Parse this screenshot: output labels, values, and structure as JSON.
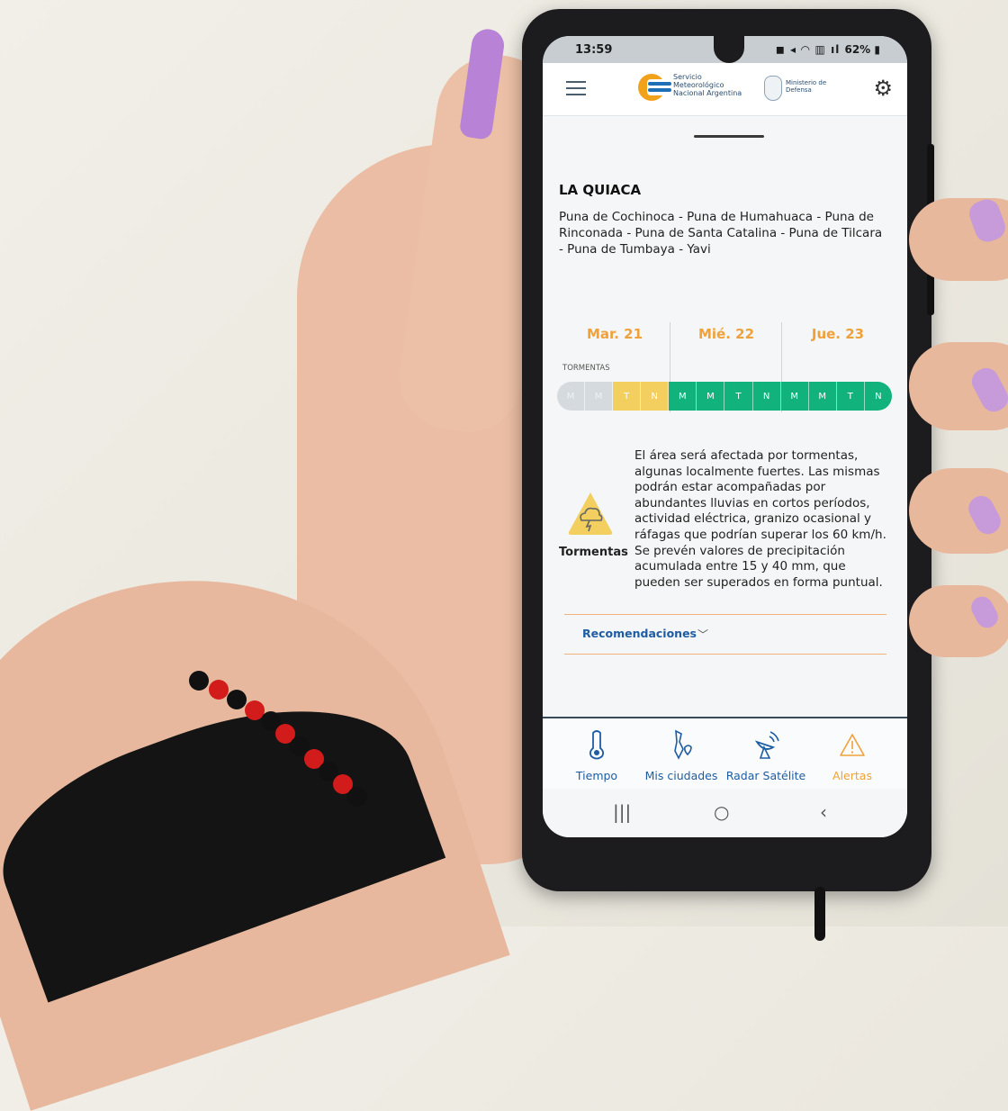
{
  "status_bar": {
    "time": "13:59",
    "icons": "62%",
    "battery": "62%"
  },
  "app_bar": {
    "logo_text": "Servicio Meteorológico Nacional Argentina",
    "ministry_text": "Ministerio de Defensa"
  },
  "alert": {
    "location": "LA QUIACA",
    "zones": "Puna de Cochinoca - Puna de Humahuaca - Puna de Rinconada - Puna de Santa Catalina - Puna de Tilcara - Puna de Tumbaya - Yavi",
    "days": [
      "Mar. 21",
      "Mié. 22",
      "Jue. 23"
    ],
    "risk_label": "TORMENTAS",
    "periods": [
      {
        "label": "M",
        "level": "none"
      },
      {
        "label": "M",
        "level": "none"
      },
      {
        "label": "T",
        "level": "yellow"
      },
      {
        "label": "N",
        "level": "yellow"
      },
      {
        "label": "M",
        "level": "green"
      },
      {
        "label": "M",
        "level": "green"
      },
      {
        "label": "T",
        "level": "green"
      },
      {
        "label": "N",
        "level": "green"
      },
      {
        "label": "M",
        "level": "green"
      },
      {
        "label": "M",
        "level": "green"
      },
      {
        "label": "T",
        "level": "green"
      },
      {
        "label": "N",
        "level": "green"
      }
    ],
    "level_colors": {
      "none": "#d4dade",
      "yellow": "#f3cf5f",
      "green": "#12b27c"
    },
    "event_name": "Tormentas",
    "description": "El área será afectada por tormentas, algunas localmente fuertes. Las mismas podrán estar acompañadas por abundantes lluvias en cortos períodos, actividad eléctrica, granizo ocasional y ráfagas que podrían superar los 60 km/h. Se prevén valores de precipitación acumulada entre 15 y 40 mm, que pueden ser superados en forma puntual.",
    "recommendations_label": "Recomendaciones"
  },
  "bottom_nav": [
    {
      "label": "Tiempo",
      "icon": "thermometer-icon"
    },
    {
      "label": "Mis ciudades",
      "icon": "map-pin-icon"
    },
    {
      "label": "Radar Satélite",
      "icon": "satellite-icon"
    },
    {
      "label": "Alertas",
      "icon": "warning-icon"
    }
  ],
  "system_nav": {
    "recents": "|||",
    "home": "○",
    "back": "‹"
  },
  "colors": {
    "accent_orange": "#f0a139",
    "link_blue": "#1f5da3"
  }
}
